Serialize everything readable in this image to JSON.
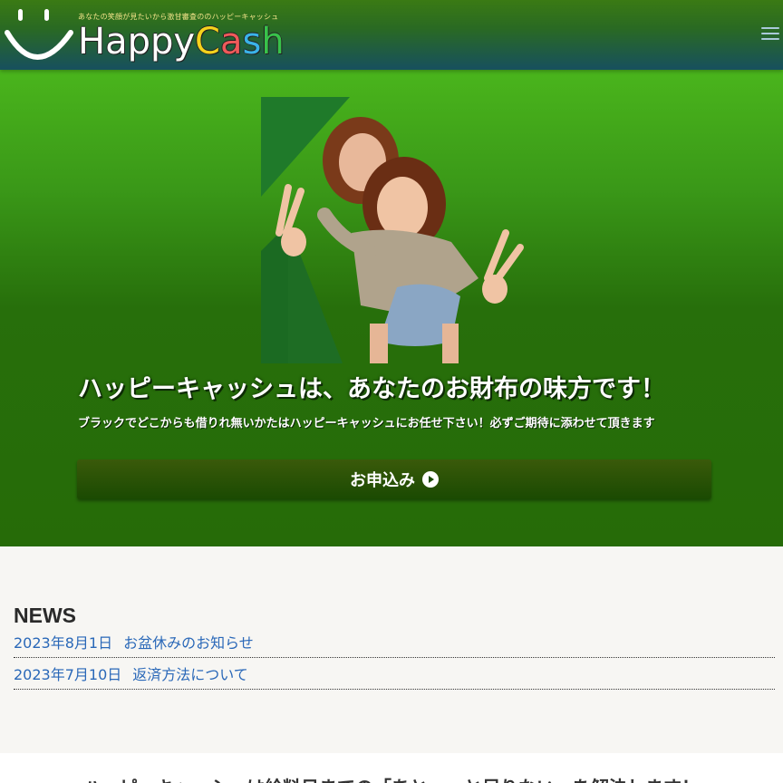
{
  "header": {
    "tagline": "あなたの笑顔が見たいから激甘審査ののハッピーキャッシュ",
    "brand_letters": [
      {
        "ch": "H",
        "color": "#ffffff"
      },
      {
        "ch": "a",
        "color": "#ffffff"
      },
      {
        "ch": "p",
        "color": "#ffffff"
      },
      {
        "ch": "p",
        "color": "#ffffff"
      },
      {
        "ch": "y",
        "color": "#ffffff"
      },
      {
        "ch": "C",
        "color": "#f5d21c"
      },
      {
        "ch": "a",
        "color": "#ef5a5a"
      },
      {
        "ch": "s",
        "color": "#3ab3e8"
      },
      {
        "ch": "h",
        "color": "#38c24a"
      }
    ],
    "menu_icon": "hamburger-icon"
  },
  "hero": {
    "title": "ハッピーキャッシュは、あなたのお財布の味方です！",
    "subtitle": "ブラックでどこからも借りれ無いかたはハッピーキャッシュにお任せ下さい！必ずご期待に添わせて頂きます",
    "apply_label": "お申込み",
    "apply_icon": "play-circle-icon",
    "image_alt": "two-women-peace-sign-photo"
  },
  "news": {
    "title": "NEWS",
    "items": [
      {
        "date": "2023年8月1日",
        "title": "お盆休みのお知らせ"
      },
      {
        "date": "2023年7月10日",
        "title": "返済方法について"
      }
    ]
  },
  "bottom": {
    "text": "ハッピーキャッシュは給料日までの「あと一っと足りない」を解決します！"
  },
  "colors": {
    "header_top": "#3a7a14",
    "header_bottom": "#17505e",
    "hero_green": "#276f0b",
    "button_green": "#1a4a02",
    "link_blue": "#2a68b8",
    "news_bg": "#f7f6f3"
  }
}
